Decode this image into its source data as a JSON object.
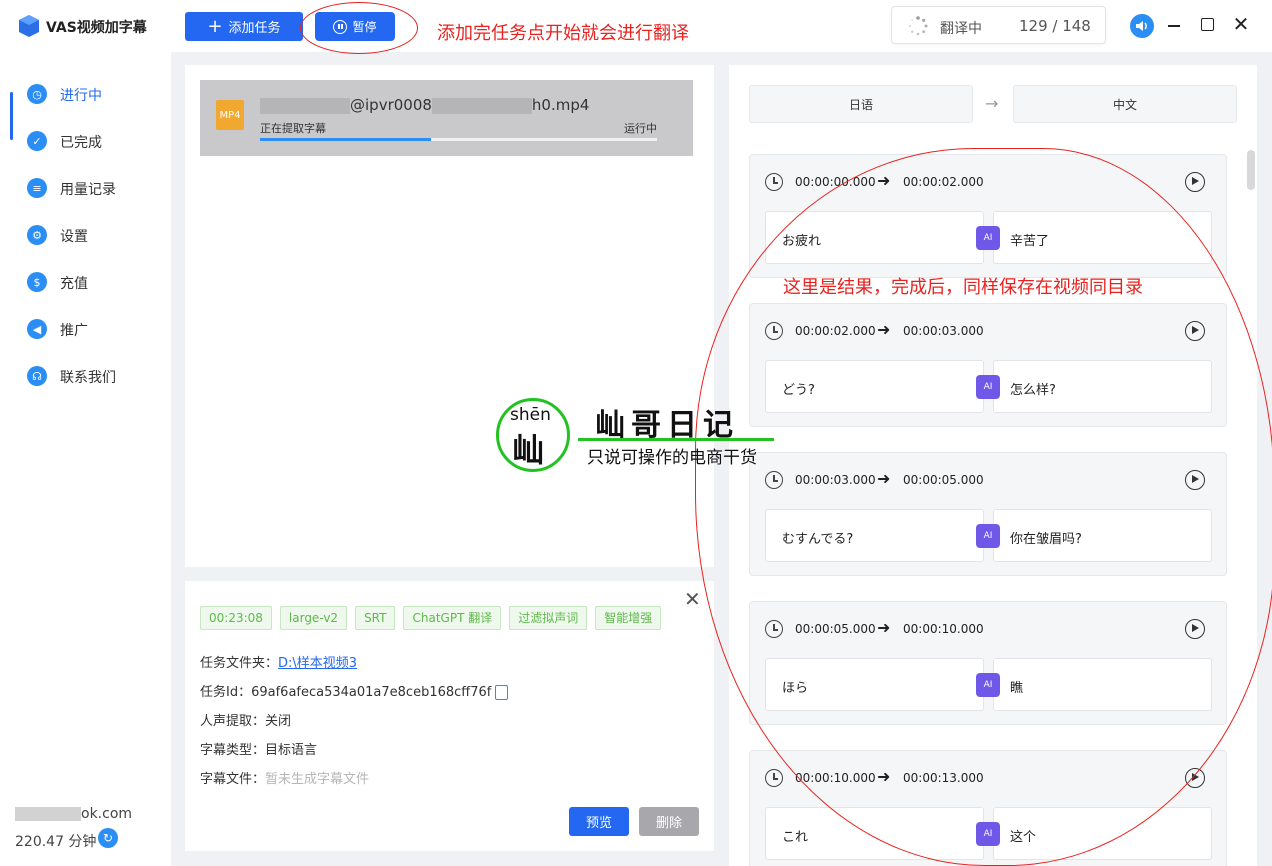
{
  "app": {
    "title": "VAS视频加字幕"
  },
  "toolbar": {
    "add_task_label": "添加任务",
    "pause_label": "暂停"
  },
  "annotations": {
    "top": "添加完任务点开始就会进行翻译",
    "result": "这里是结果，完成后，同样保存在视频同目录"
  },
  "progress": {
    "label": "翻译中",
    "count": "129 / 148"
  },
  "sidebar": {
    "items": [
      {
        "label": "进行中",
        "icon": "clock-icon"
      },
      {
        "label": "已完成",
        "icon": "check-icon"
      },
      {
        "label": "用量记录",
        "icon": "list-icon"
      },
      {
        "label": "设置",
        "icon": "settings-icon"
      },
      {
        "label": "充值",
        "icon": "coins-icon"
      },
      {
        "label": "推广",
        "icon": "megaphone-icon"
      },
      {
        "label": "联系我们",
        "icon": "headset-icon"
      }
    ],
    "email_suffix": "ok.com",
    "balance": "220.47 分钟"
  },
  "task": {
    "file_icon_label": "MP4",
    "file_name_mid": "@ipvr0008",
    "file_name_end": "h0.mp4",
    "status": "正在提取字幕",
    "state": "运行中",
    "progress_fraction": 0.43
  },
  "details": {
    "tags": [
      "00:23:08",
      "large-v2",
      "SRT",
      "ChatGPT 翻译",
      "过滤拟声词",
      "智能增强"
    ],
    "folder_label": "任务文件夹：",
    "folder_value": "D:\\样本视频3",
    "task_id_label": "任务Id：",
    "task_id_value": "69af6afeca534a01a7e8ceb168cff76f",
    "vocal_label": "人声提取：",
    "vocal_value": "关闭",
    "subtype_label": "字幕类型：",
    "subtype_value": "目标语言",
    "subfile_label": "字幕文件：",
    "subfile_value": "暂未生成字幕文件",
    "preview_label": "预览",
    "delete_label": "删除"
  },
  "languages": {
    "source": "日语",
    "target": "中文"
  },
  "segments": [
    {
      "start": "00:00:00.000",
      "end": "00:00:02.000",
      "source": "お疲れ",
      "target": "辛苦了"
    },
    {
      "start": "00:00:02.000",
      "end": "00:00:03.000",
      "source": "どう?",
      "target": "怎么样?"
    },
    {
      "start": "00:00:03.000",
      "end": "00:00:05.000",
      "source": "むすんでる?",
      "target": "你在皱眉吗?"
    },
    {
      "start": "00:00:05.000",
      "end": "00:00:10.000",
      "source": "ほら",
      "target": "瞧"
    },
    {
      "start": "00:00:10.000",
      "end": "00:00:13.000",
      "source": "これ",
      "target": "这个"
    }
  ],
  "watermark": {
    "pinyin": "shēn",
    "char": "屾",
    "title": "屾哥日记",
    "subtitle": "只说可操作的电商干货"
  },
  "colors": {
    "primary": "#2468f2",
    "annotation": "#e8231f",
    "tag_green": "#5fb84c",
    "ai_purple": "#6f57e8"
  }
}
